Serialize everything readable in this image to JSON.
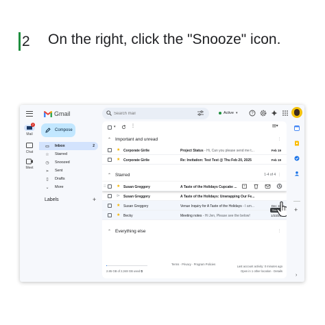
{
  "instruction": {
    "step_number": "2",
    "text": "On the right, click the \"Snooze\" icon."
  },
  "app": {
    "name": "Gmail",
    "search_placeholder": "Search mail",
    "status": "Active",
    "accent_color": "#0b57d0",
    "brand_colors": [
      "#ea4335",
      "#fbbc04",
      "#34a853",
      "#4285f4"
    ]
  },
  "rail": {
    "items": [
      {
        "label": "Mail",
        "icon": "mail-icon",
        "badge": "2"
      },
      {
        "label": "Chat",
        "icon": "chat-icon"
      },
      {
        "label": "Meet",
        "icon": "meet-icon"
      }
    ]
  },
  "sidebar": {
    "compose_label": "Compose",
    "items": [
      {
        "label": "Inbox",
        "icon": "inbox-icon",
        "count": "2",
        "active": true
      },
      {
        "label": "Starred",
        "icon": "star-icon"
      },
      {
        "label": "Snoozed",
        "icon": "clock-icon"
      },
      {
        "label": "Sent",
        "icon": "send-icon"
      },
      {
        "label": "Drafts",
        "icon": "draft-icon"
      },
      {
        "label": "More",
        "icon": "chevron-down-icon"
      }
    ],
    "labels_heading": "Labels"
  },
  "sections": {
    "important": {
      "title": "Important and unread"
    },
    "starred": {
      "title": "Starred",
      "pager": "1-4 of 4"
    },
    "everything": {
      "title": "Everything else"
    }
  },
  "important_rows": [
    {
      "sender": "Corporate Girlie",
      "subject": "Project Status",
      "preview": " - Hi, Can you please send me t...",
      "date": "Feb 19",
      "unread": true,
      "starred": true
    },
    {
      "sender": "Corporate Girlie",
      "subject": "Re: Invitation: Test Test @ Thu Feb 20, 2025",
      "preview": "",
      "date": "Feb 19",
      "unread": true,
      "starred": true
    }
  ],
  "starred_rows": [
    {
      "sender": "Susan Greggory",
      "subject": "A Taste of the Holidays Cupcake ...",
      "preview": "",
      "date": "",
      "unread": true,
      "starred": true,
      "hover": true
    },
    {
      "sender": "Susan Greggory",
      "subject": "A Taste of the Holidays: Unwrapping Our Fe...",
      "preview": "",
      "date": "",
      "unread": true,
      "starred": false
    },
    {
      "sender": "Susan Greggory",
      "subject": "Venue Inquiry for A Taste of the Holidays",
      "preview": " - I am...",
      "date": "Dec 10",
      "unread": false,
      "starred": true
    },
    {
      "sender": "Becky",
      "subject": "Meeting notes",
      "preview": " - Hi Jen, Please see the below!",
      "date": "1/23/25",
      "unread": false,
      "starred": true
    }
  ],
  "tooltip": "Snooze",
  "footer": {
    "storage": "2.85 GB of 2,048 GB used",
    "storage_fraction": 0.0014,
    "links": "Terms · Privacy · Program Policies",
    "activity_line1": "Last account activity: 0 minutes ago",
    "activity_line2": "Open in 1 other location · Details"
  }
}
